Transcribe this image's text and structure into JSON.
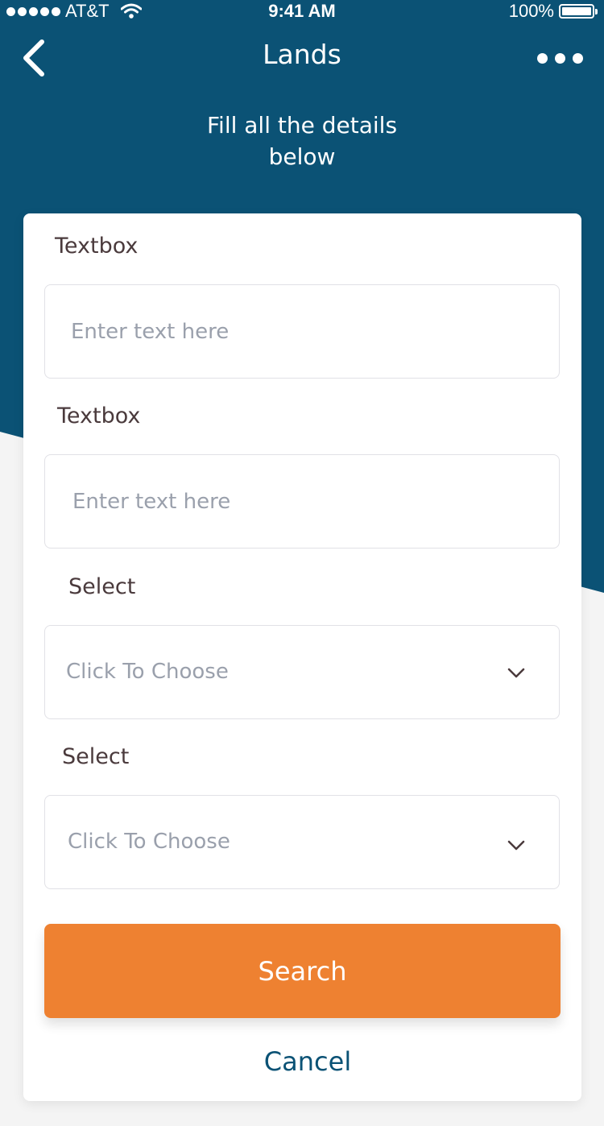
{
  "status": {
    "carrier": "AT&T",
    "time": "9:41 AM",
    "battery": "100%"
  },
  "nav": {
    "title": "Lands",
    "back_icon": "chevron-left-icon",
    "more_icon": "ellipsis-icon"
  },
  "subtitle": "Fill all the details below",
  "form": {
    "textbox1": {
      "label": "Textbox",
      "placeholder": "Enter text here"
    },
    "textbox2": {
      "label": "Textbox",
      "placeholder": "Enter text here"
    },
    "select1": {
      "label": "Select",
      "value": "Click To Choose"
    },
    "select2": {
      "label": "Select",
      "value": "Click To Choose"
    }
  },
  "actions": {
    "search": "Search",
    "cancel": "Cancel"
  },
  "colors": {
    "header": "#0b5275",
    "accent": "#ee8131",
    "background": "#f4f4f4",
    "card": "#ffffff"
  }
}
